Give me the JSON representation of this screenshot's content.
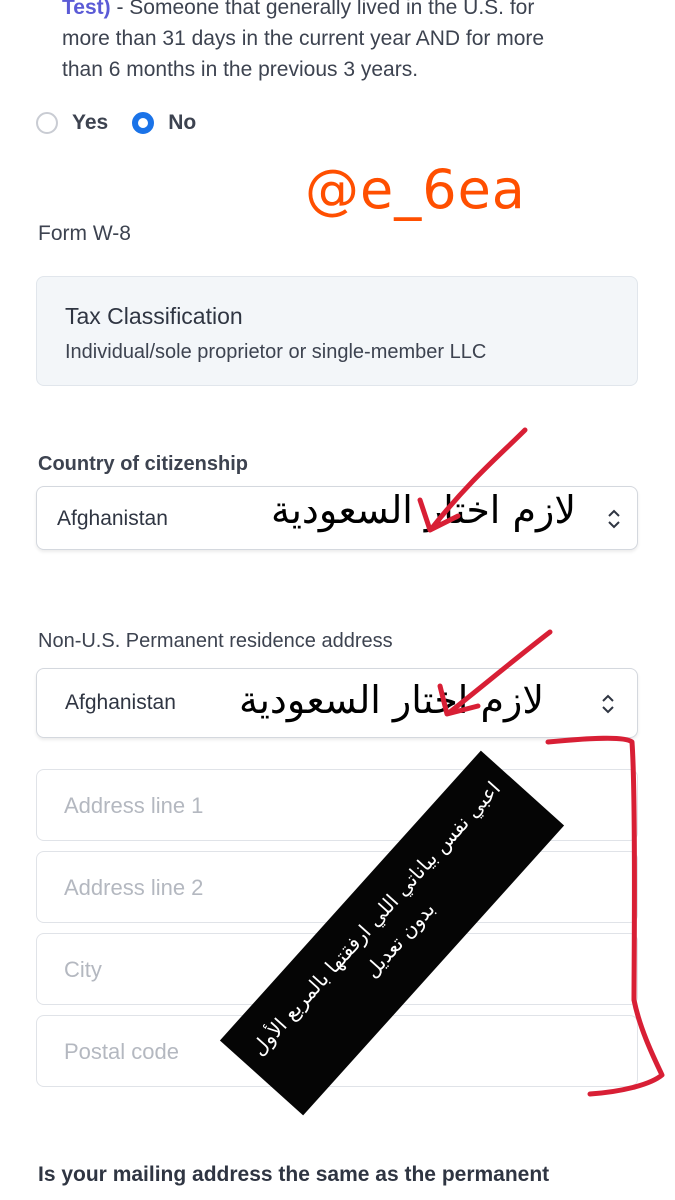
{
  "intro": {
    "link_text": "Test)",
    "text_line1": " - Someone that generally lived in the U.S. for",
    "text_line2": "more than 31 days in the current year AND for more",
    "text_line3": "than 6 months in the previous 3 years."
  },
  "residency_radio": {
    "yes_label": "Yes",
    "no_label": "No",
    "selected": "No"
  },
  "watermark": "@e_6ea",
  "form_name": "Form W-8",
  "tax_classification": {
    "title": "Tax Classification",
    "value": "Individual/sole proprietor or single-member LLC"
  },
  "citizenship": {
    "label": "Country of citizenship",
    "value": "Afghanistan",
    "annotation": "لازم اختار السعودية"
  },
  "residence": {
    "label": "Non-U.S. Permanent residence address",
    "country_value": "Afghanistan",
    "annotation": "لازم اختار السعودية",
    "address_line1_placeholder": "Address line 1",
    "address_line2_placeholder": "Address line 2",
    "city_placeholder": "City",
    "postal_code_placeholder": "Postal code"
  },
  "note": {
    "line1": "اعبي نفس بياناتي اللي ارفقتها بالمربع الأول",
    "line2": "بدون تعديل"
  },
  "mailing_question": "Is your mailing address the same as the permanent",
  "colors": {
    "accent": "#1a73e8",
    "watermark": "#ff4f00",
    "annotation_red": "#d81f35"
  }
}
